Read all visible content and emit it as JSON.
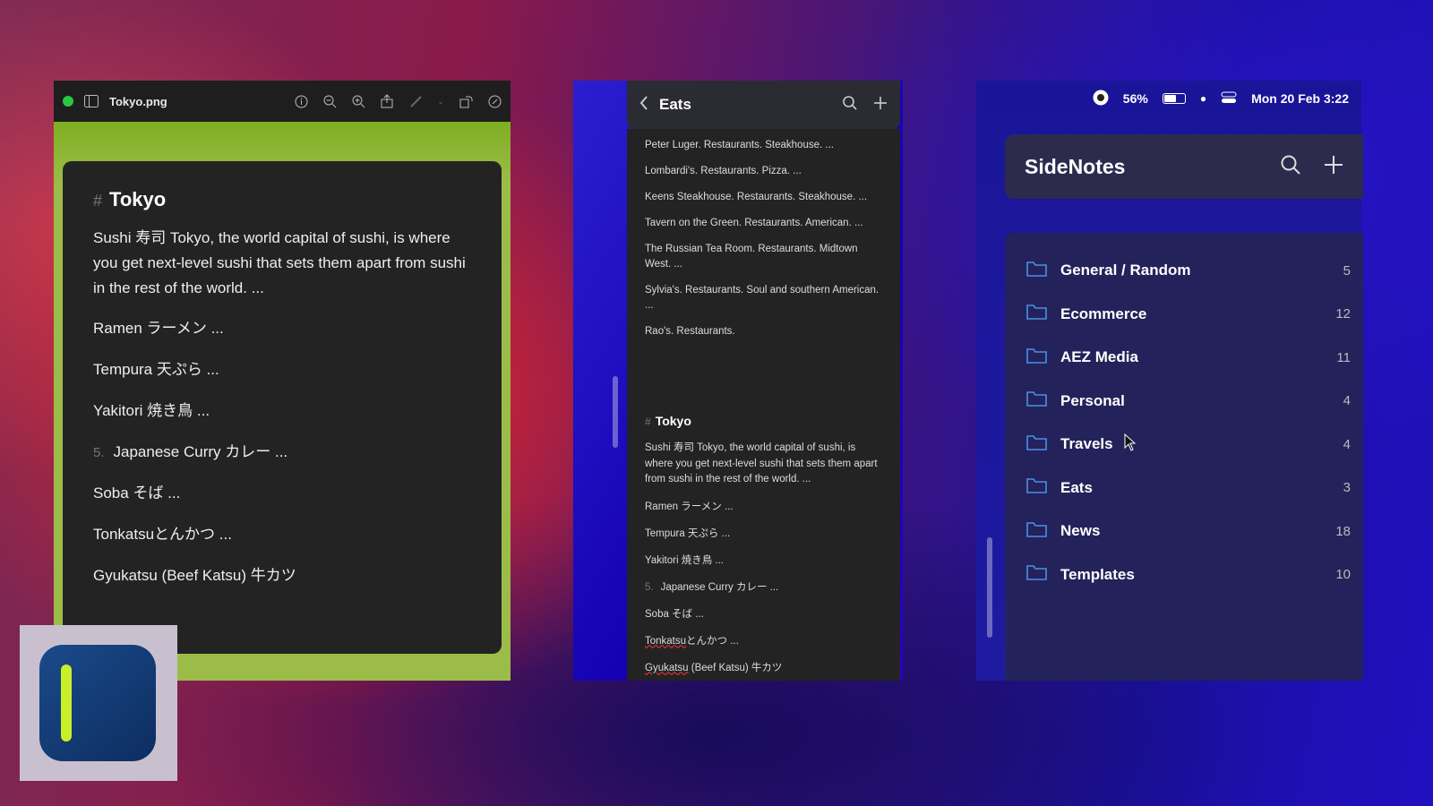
{
  "preview": {
    "filename": "Tokyo.png",
    "note": {
      "title": "Tokyo",
      "intro": "Sushi 寿司 Tokyo, the world capital of sushi, is where you get next-level sushi that sets them apart from sushi in the rest of the world. ...",
      "items": [
        "Ramen ラーメン ...",
        "Tempura 天ぷら ...",
        "Yakitori 焼き鳥 ...",
        "Japanese Curry カレー ...",
        "Soba そば ...",
        "Tonkatsuとんかつ ...",
        "Gyukatsu (Beef Katsu) 牛カツ"
      ],
      "curry_number": "5."
    }
  },
  "eats": {
    "title": "Eats",
    "restaurants": [
      "Peter Luger. Restaurants. Steakhouse. ...",
      "Lombardi's. Restaurants. Pizza. ...",
      "Keens Steakhouse. Restaurants. Steakhouse. ...",
      "Tavern on the Green. Restaurants. American. ...",
      "The Russian Tea Room. Restaurants. Midtown West. ...",
      "Sylvia's. Restaurants. Soul and southern American. ...",
      "Rao's. Restaurants."
    ],
    "note": {
      "title": "Tokyo",
      "intro": "Sushi 寿司 Tokyo, the world capital of sushi, is where you get next-level sushi that sets them apart from sushi in the rest of the world. ...",
      "items": [
        "Ramen ラーメン ...",
        "Tempura 天ぷら ...",
        "Yakitori 焼き鳥 ..."
      ],
      "curry_number": "5.",
      "curry": "Japanese Curry カレー ...",
      "soba": "Soba そば ...",
      "tonkatsu_word": "Tonkatsu",
      "tonkatsu_rest": "とんかつ ...",
      "gyukatsu_word": "Gyukatsu",
      "gyukatsu_rest": " (Beef Katsu) 牛カツ"
    }
  },
  "menubar": {
    "battery": "56%",
    "datetime": "Mon 20 Feb  3:22"
  },
  "sidenotes": {
    "title": "SideNotes",
    "folders": [
      {
        "name": "General / Random",
        "count": "5"
      },
      {
        "name": "Ecommerce",
        "count": "12"
      },
      {
        "name": "AEZ Media",
        "count": "11"
      },
      {
        "name": "Personal",
        "count": "4"
      },
      {
        "name": "Travels",
        "count": "4"
      },
      {
        "name": "Eats",
        "count": "3"
      },
      {
        "name": "News",
        "count": "18"
      },
      {
        "name": "Templates",
        "count": "10"
      }
    ]
  },
  "colors": {
    "folder_icon": "#4a8fe8",
    "logo_bar": "#c8ef2a"
  }
}
